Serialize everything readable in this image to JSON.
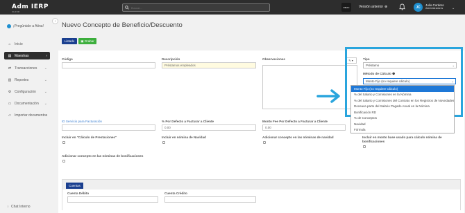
{
  "topbar": {
    "brand": "Adm IERP",
    "brand_sub": "CLOUD",
    "search_placeholder": "Buscar...",
    "square_label": "DMAC",
    "prev_version": "Versión anterior",
    "user_name": "Julio Cordero",
    "user_role": "Administradores",
    "avatar_initials": "JC"
  },
  "sidebar": {
    "ask": "¡Pregúntale a Atina!",
    "items": [
      {
        "label": "Inicio",
        "icon": "home-icon"
      },
      {
        "label": "Maestras",
        "icon": "book-icon"
      },
      {
        "label": "Transacciones",
        "icon": "exchange-icon"
      },
      {
        "label": "Reportes",
        "icon": "report-icon"
      },
      {
        "label": "Configuración",
        "icon": "gear-icon"
      },
      {
        "label": "Documentación",
        "icon": "document-icon"
      },
      {
        "label": "Importar documentos",
        "icon": "folder-icon"
      }
    ],
    "chat": "Chat Interno"
  },
  "main": {
    "title": "Nuevo Concepto de Beneficio/Descuento",
    "btn_list": "Listado",
    "btn_save": "Grabar"
  },
  "form": {
    "codigo_label": "Código",
    "codigo_value": "",
    "descripcion_label": "Descripción",
    "descripcion_value": "Préstamos empleados",
    "observaciones_label": "Observaciones",
    "tool_label": "✎ ▾",
    "tipo_label": "Tipo",
    "tipo_value": "Préstamo",
    "metodo_label": "Método de Cálculo",
    "metodo_value": "Monto Fijo (no requiere cálculo)",
    "id_servicio_label": "ID Servicio para Facturación",
    "id_servicio_value": "",
    "pct_defecto_label": "% Por Defecto a Facturar a Cliente",
    "pct_defecto_value": "0.00",
    "fee_label": "Monto Fee Por Defecto a Facturar a Cliente",
    "fee_value": "0.00",
    "chk_prestaciones": "Incluir en \"Cálculo de Prestaciones\"",
    "chk_navidad": "Incluir en nómina de Navidad",
    "chk_adicionar_navidad": "Adicionar concepto en las nóminas de navidad",
    "chk_bonificaciones": "Incluir en monto base usado para cálculo nómina de bonificaciones",
    "chk_adicionar_bonif": "Adicionar concepto en las nóminas de bonificaciones",
    "accounts_tab": "Cuentas",
    "debito_label": "Cuenta Débito",
    "credito_label": "Cuenta Crédito"
  },
  "dropdown_options": [
    "Monto Fijo (no requiere cálculo)",
    "% del Salario y Comisiones en la Nómina",
    "% del Salario y Comisiones del Contrato en los Registros de Novedades",
    "Doceava parte del Salario Pagado Anual en la Nómina",
    "Bonificación RD",
    "% de Conceptos",
    "Navidad",
    "Fórmula"
  ],
  "colors": {
    "highlight": "#2aa5dd",
    "primary": "#1a3f8f",
    "success": "#3cae3c",
    "selected": "#1e78d7"
  }
}
